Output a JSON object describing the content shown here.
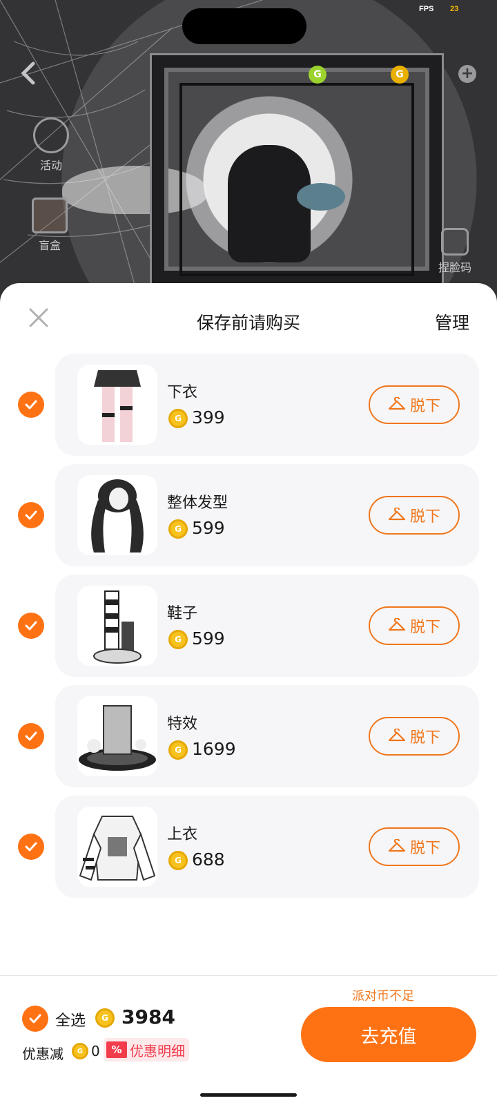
{
  "status": {
    "fps_label": "FPS",
    "fps_value": "23"
  },
  "background": {
    "side_buttons": {
      "activity": "活动",
      "blind_box": "盲盒",
      "face_code": "捏脸码"
    }
  },
  "sheet": {
    "title": "保存前请购买",
    "manage_label": "管理",
    "remove_label": "脱下",
    "items": [
      {
        "name": "下衣",
        "price": "399",
        "checked": true,
        "thumb": "pants"
      },
      {
        "name": "整体发型",
        "price": "599",
        "checked": true,
        "thumb": "hair"
      },
      {
        "name": "鞋子",
        "price": "599",
        "checked": true,
        "thumb": "shoes"
      },
      {
        "name": "特效",
        "price": "1699",
        "checked": true,
        "thumb": "effect"
      },
      {
        "name": "上衣",
        "price": "688",
        "checked": true,
        "thumb": "top"
      }
    ]
  },
  "footer": {
    "insufficient_text": "派对币不足",
    "select_all_label": "全选",
    "total": "3984",
    "discount_label": "优惠减",
    "discount_value": "0",
    "discount_badge": "%",
    "discount_detail_label": "优惠明细",
    "recharge_label": "去充值"
  },
  "colors": {
    "accent": "#ff7214",
    "accent_outline": "#f0761b",
    "coin": "#f7c21d",
    "discount_red": "#f23c4c"
  }
}
